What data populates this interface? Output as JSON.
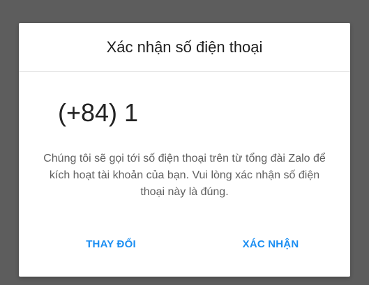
{
  "dialog": {
    "title": "Xác nhận số điện thoại",
    "phone_number": "(+84) 1",
    "message": "Chúng tôi sẽ gọi tới số điện thoại trên từ tổng đài Zalo để kích hoạt tài khoản của bạn. Vui lòng xác nhận số điện thoại này là đúng.",
    "change_label": "THAY ĐỔI",
    "confirm_label": "XÁC NHẬN"
  },
  "colors": {
    "accent": "#1b8ef2",
    "backdrop": "#5d5d5d",
    "dialog_background": "#ffffff"
  }
}
